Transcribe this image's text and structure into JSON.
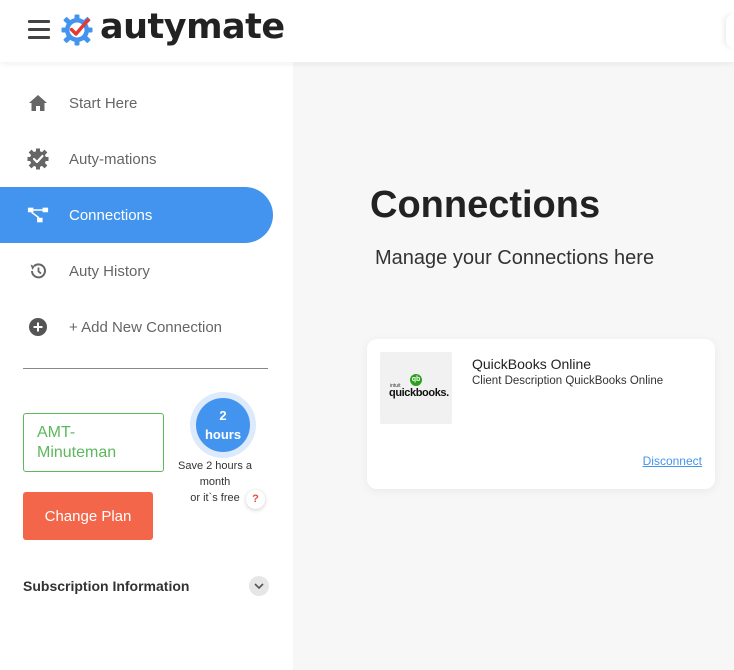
{
  "brand": {
    "name": "autymate"
  },
  "sidebar": {
    "items": [
      {
        "label": "Start Here",
        "icon": "home-icon"
      },
      {
        "label": "Auty-mations",
        "icon": "gear-check-icon"
      },
      {
        "label": "Connections",
        "icon": "connections-icon",
        "active": true
      },
      {
        "label": "Auty History",
        "icon": "history-icon"
      },
      {
        "label": "+ Add New Connection",
        "icon": "plus-circle-icon"
      }
    ],
    "plan": {
      "name": "AMT-Minuteman",
      "hours_value": "2",
      "hours_unit": "hours",
      "save_line1": "Save 2 hours a month",
      "save_line2": "or it`s free",
      "help": "?",
      "change_plan_label": "Change Plan"
    },
    "subscription_label": "Subscription Information"
  },
  "main": {
    "title": "Connections",
    "subtitle": "Manage your Connections here",
    "connections": [
      {
        "name": "QuickBooks Online",
        "description": "Client Description QuickBooks Online",
        "logo_small": "intuit",
        "logo_text": "quickbooks.",
        "action": "Disconnect"
      }
    ]
  },
  "colors": {
    "accent": "#4394ee",
    "plan_green": "#5cb85c",
    "cta": "#f4664a",
    "logo_red": "#e53935"
  }
}
